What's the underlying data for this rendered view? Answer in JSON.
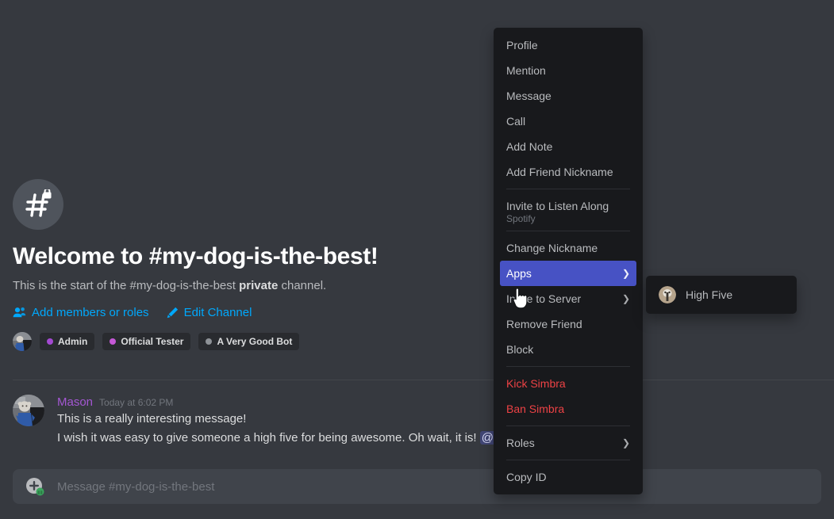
{
  "colors": {
    "background": "#36393f",
    "menu_background": "#18191c",
    "accent_blurple": "#4752c4",
    "link_blue": "#00a8fc",
    "danger_red": "#ed4245",
    "composer_background": "#40444b"
  },
  "channel": {
    "name": "#my-dog-is-the-best",
    "icon": "hash-lock-icon",
    "welcome_title": "Welcome to #my-dog-is-the-best!",
    "intro_prefix": "This is the start of the #my-dog-is-the-best ",
    "intro_bold": "private",
    "intro_suffix": " channel.",
    "actions": [
      {
        "label": "Add members or roles",
        "icon": "add-members-icon"
      },
      {
        "label": "Edit Channel",
        "icon": "pencil-icon"
      }
    ],
    "roles": [
      {
        "label": "Admin",
        "dot_color": "#a44ad2"
      },
      {
        "label": "Official Tester",
        "dot_color": "#c558d6"
      },
      {
        "label": "A Very Good Bot",
        "dot_color": "#8e9297"
      }
    ]
  },
  "message": {
    "author": "Mason",
    "author_color": "#a457d3",
    "timestamp": "Today at 6:02 PM",
    "line1": "This is a really interesting message!",
    "line2_prefix": "I wish it was easy to give someone a high five for being awesome. Oh wait, it is! ",
    "mention": "@S"
  },
  "composer": {
    "placeholder": "Message #my-dog-is-the-best",
    "upload_icon": "upload-plus-icon"
  },
  "context_menu": {
    "items": [
      {
        "label": "Profile",
        "type": "item"
      },
      {
        "label": "Mention",
        "type": "item"
      },
      {
        "label": "Message",
        "type": "item"
      },
      {
        "label": "Call",
        "type": "item"
      },
      {
        "label": "Add Note",
        "type": "item"
      },
      {
        "label": "Add Friend Nickname",
        "type": "item"
      },
      {
        "label": "Invite to Listen Along",
        "sublabel": "Spotify",
        "type": "item-with-sub"
      },
      {
        "label": "Change Nickname",
        "type": "item"
      },
      {
        "label": "Apps",
        "type": "submenu",
        "selected": true
      },
      {
        "label": "Invite to Server",
        "type": "submenu"
      },
      {
        "label": "Remove Friend",
        "type": "item"
      },
      {
        "label": "Block",
        "type": "item"
      },
      {
        "label": "Kick Simbra",
        "type": "danger"
      },
      {
        "label": "Ban Simbra",
        "type": "danger"
      },
      {
        "label": "Roles",
        "type": "submenu"
      },
      {
        "label": "Copy ID",
        "type": "item"
      }
    ]
  },
  "submenu": {
    "items": [
      {
        "label": "High Five",
        "icon": "app-avatar-icon"
      }
    ]
  }
}
